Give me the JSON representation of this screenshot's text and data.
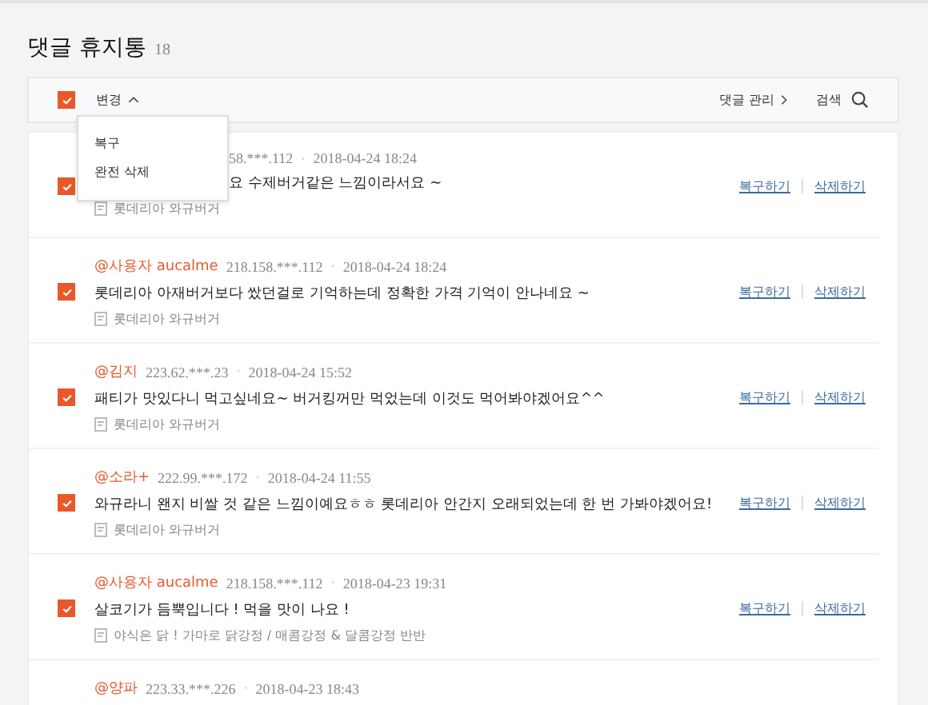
{
  "title": "댓글 휴지통",
  "count": "18",
  "toolbar": {
    "select_all_checked": true,
    "change_label": "변경",
    "change_expanded": true,
    "manage_link": "댓글 관리",
    "search_label": "검색"
  },
  "dropdown": {
    "items": [
      "복구",
      "완전 삭제"
    ]
  },
  "separator": "·",
  "comments": [
    {
      "checked": true,
      "ip": "58.***.112",
      "date": "2018-04-24 18:24",
      "text": "요 수제버거같은 느낌이라서요 ~",
      "source": "롯데리아 와규버거",
      "restore": "복구하기",
      "delete": "삭제하기"
    },
    {
      "checked": true,
      "author": "@사용자 aucalme",
      "ip": "218.158.***.112",
      "date": "2018-04-24 18:24",
      "text": "롯데리아 아재버거보다 쌌던걸로 기억하는데 정확한 가격 기억이 안나네요 ~",
      "source": "롯데리아 와규버거",
      "restore": "복구하기",
      "delete": "삭제하기"
    },
    {
      "checked": true,
      "author": "@김지",
      "ip": "223.62.***.23",
      "date": "2018-04-24 15:52",
      "text": "패티가 맛있다니 먹고싶네요~ 버거킹꺼만 먹었는데 이것도 먹어봐야겠어요^^",
      "source": "롯데리아 와규버거",
      "restore": "복구하기",
      "delete": "삭제하기"
    },
    {
      "checked": true,
      "author": "@소라+",
      "ip": "222.99.***.172",
      "date": "2018-04-24 11:55",
      "text": "와규라니 왠지 비쌀 것 같은 느낌이예요ㅎㅎ 롯데리아 안간지 오래되었는데 한 번 가봐야겠어요!",
      "source": "롯데리아 와규버거",
      "restore": "복구하기",
      "delete": "삭제하기"
    },
    {
      "checked": true,
      "author": "@사용자 aucalme",
      "ip": "218.158.***.112",
      "date": "2018-04-23 19:31",
      "text": "살코기가 듬뿍입니다 ! 먹을 맛이 나요 !",
      "source": "야식은 닭 ! 가마로 닭강정 / 매콤강정 & 달콤강정 반반",
      "restore": "복구하기",
      "delete": "삭제하기"
    },
    {
      "author": "@양파",
      "ip": "223.33.***.226",
      "date": "2018-04-23 18:43"
    }
  ]
}
